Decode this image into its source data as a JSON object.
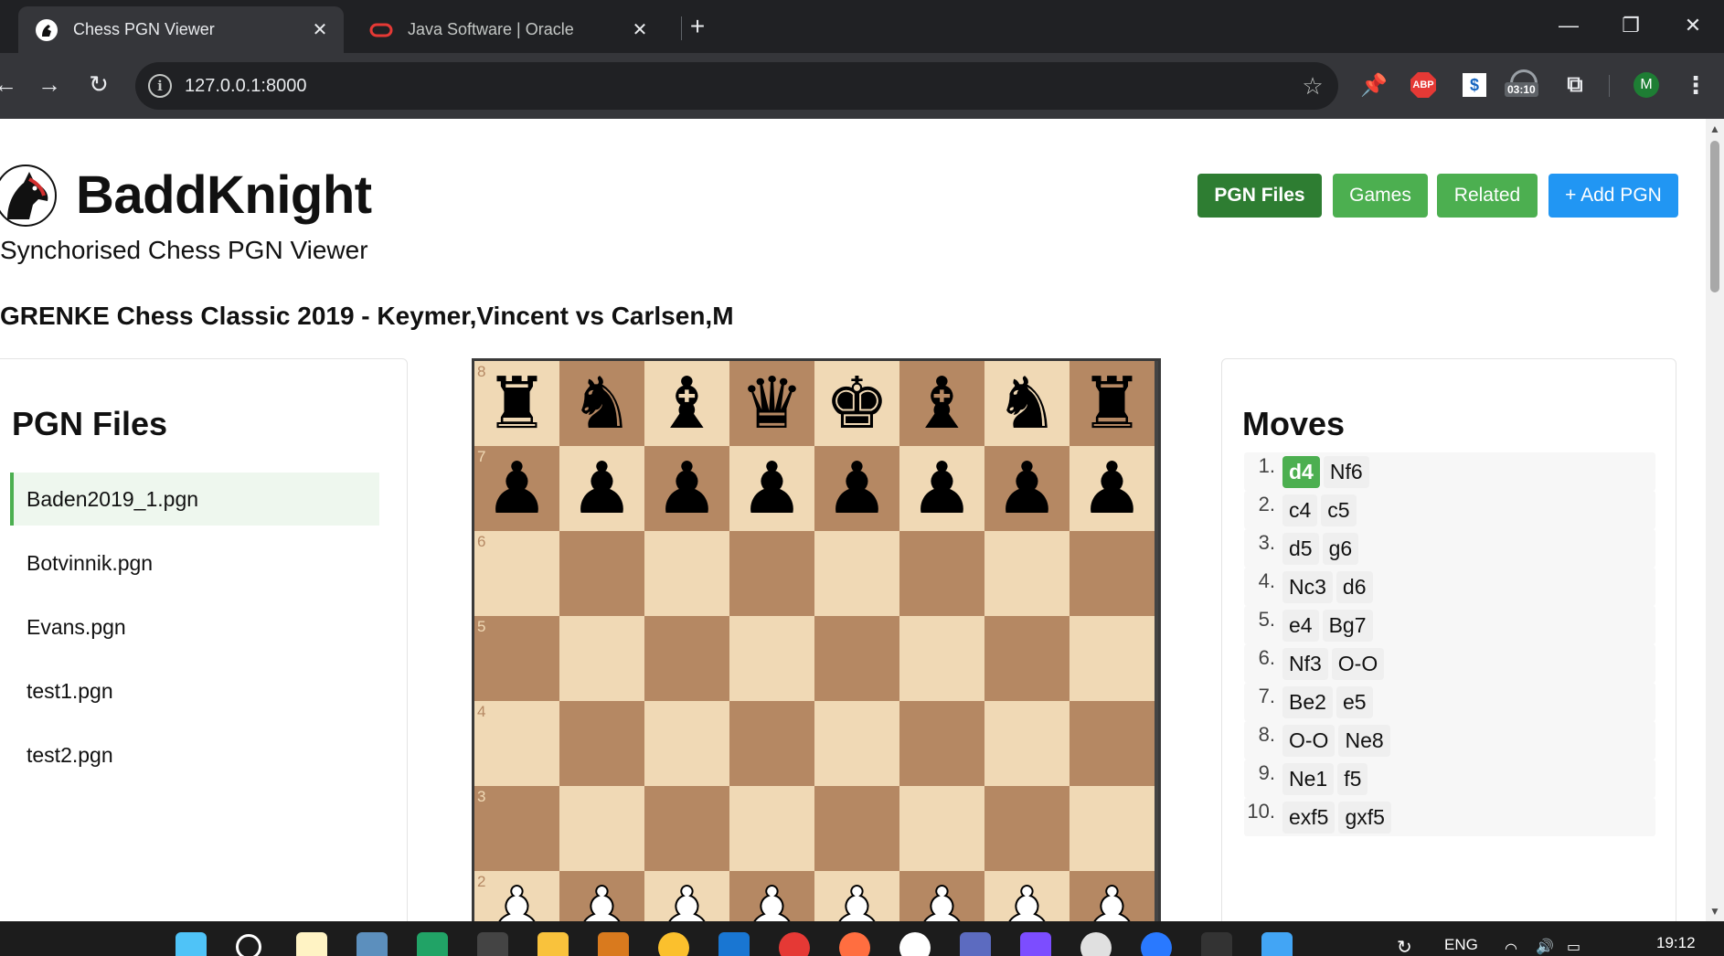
{
  "browser": {
    "tabs": [
      {
        "title": "Chess PGN Viewer",
        "active": true
      },
      {
        "title": "Java Software | Oracle",
        "active": false
      }
    ],
    "url": "127.0.0.1:8000",
    "extensions": {
      "abp": "ABP",
      "timer": "03:10",
      "profile_initial": "M"
    }
  },
  "site": {
    "title": "BaddKnight",
    "subtitle": "Synchorised Chess PGN Viewer",
    "nav": [
      "PGN Files",
      "Games",
      "Related",
      "+ Add PGN"
    ]
  },
  "game_title": "GRENKE Chess Classic 2019 - Keymer,Vincent vs Carlsen,M",
  "files_panel": {
    "heading": "PGN Files",
    "files": [
      "Baden2019_1.pgn",
      "Botvinnik.pgn",
      "Evans.pgn",
      "test1.pgn",
      "test2.pgn"
    ],
    "active_index": 0
  },
  "board": {
    "visible_ranks": [
      "8",
      "7",
      "6",
      "5",
      "4",
      "3",
      "2"
    ],
    "rows": [
      [
        "r",
        "n",
        "b",
        "q",
        "k",
        "b",
        "n",
        "r"
      ],
      [
        "p",
        "p",
        "p",
        "p",
        "p",
        "p",
        "p",
        "p"
      ],
      [
        "",
        "",
        "",
        "",
        "",
        "",
        "",
        ""
      ],
      [
        "",
        "",
        "",
        "",
        "",
        "",
        "",
        ""
      ],
      [
        "",
        "",
        "",
        "",
        "",
        "",
        "",
        ""
      ],
      [
        "",
        "",
        "",
        "",
        "",
        "",
        "",
        ""
      ],
      [
        "P",
        "P",
        "P",
        "P",
        "P",
        "P",
        "P",
        "P"
      ]
    ]
  },
  "moves_panel": {
    "heading": "Moves",
    "moves": [
      {
        "num": "1.",
        "white": "d4",
        "black": "Nf6"
      },
      {
        "num": "2.",
        "white": "c4",
        "black": "c5"
      },
      {
        "num": "3.",
        "white": "d5",
        "black": "g6"
      },
      {
        "num": "4.",
        "white": "Nc3",
        "black": "d6"
      },
      {
        "num": "5.",
        "white": "e4",
        "black": "Bg7"
      },
      {
        "num": "6.",
        "white": "Nf3",
        "black": "O-O"
      },
      {
        "num": "7.",
        "white": "Be2",
        "black": "e5"
      },
      {
        "num": "8.",
        "white": "O-O",
        "black": "Ne8"
      },
      {
        "num": "9.",
        "white": "Ne1",
        "black": "f5"
      },
      {
        "num": "10.",
        "white": "exf5",
        "black": "gxf5"
      }
    ],
    "current": "d4"
  },
  "taskbar": {
    "language": "ENG",
    "time": "19:12"
  },
  "colors": {
    "board_light": "#f0d9b5",
    "board_dark": "#b58863",
    "nav_active": "#2e7d32",
    "nav_green": "#4caf50",
    "nav_blue": "#2196f3"
  }
}
